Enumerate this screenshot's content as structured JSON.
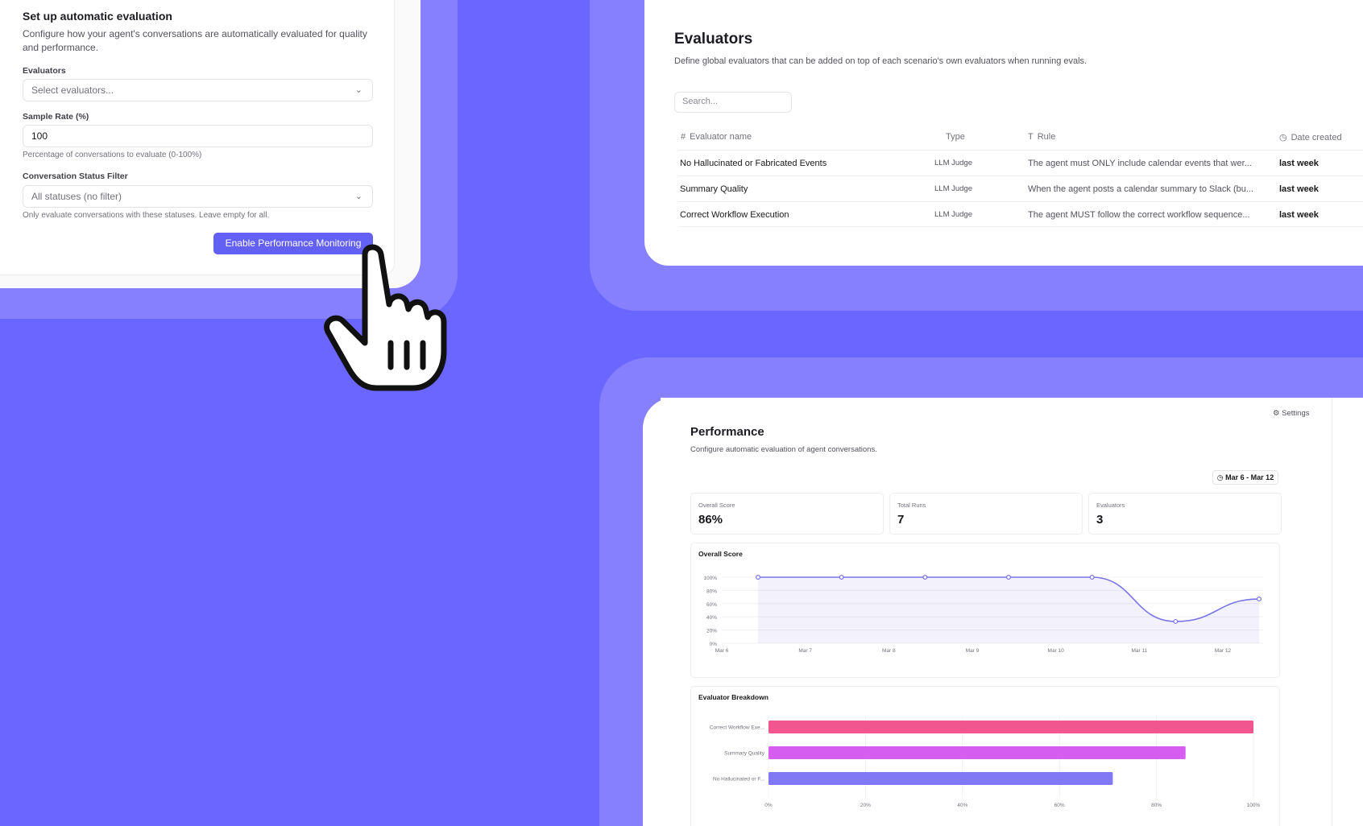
{
  "setup": {
    "title": "Set up automatic evaluation",
    "description": "Configure how your agent's conversations are automatically evaluated for quality and performance.",
    "evaluators_label": "Evaluators",
    "evaluators_placeholder": "Select evaluators...",
    "sample_rate_label": "Sample Rate (%)",
    "sample_rate_value": "100",
    "sample_rate_help": "Percentage of conversations to evaluate (0-100%)",
    "status_filter_label": "Conversation Status Filter",
    "status_filter_value": "All statuses (no filter)",
    "status_filter_help": "Only evaluate conversations with these statuses. Leave empty for all.",
    "enable_button": "Enable Performance Monitoring"
  },
  "evaluators": {
    "title": "Evaluators",
    "description": "Define global evaluators that can be added on top of each scenario's own evaluators when running evals.",
    "search_placeholder": "Search...",
    "columns": {
      "name": "Evaluator name",
      "type": "Type",
      "rule": "Rule",
      "date": "Date created"
    },
    "rows": [
      {
        "name": "No Hallucinated or Fabricated Events",
        "type": "LLM Judge",
        "rule": "The agent must ONLY include calendar events that wer...",
        "date": "last week"
      },
      {
        "name": "Summary Quality",
        "type": "LLM Judge",
        "rule": "When the agent posts a calendar summary to Slack (bu...",
        "date": "last week"
      },
      {
        "name": "Correct Workflow Execution",
        "type": "LLM Judge",
        "rule": "The agent MUST follow the correct workflow sequence...",
        "date": "last week"
      }
    ]
  },
  "performance": {
    "settings_label": "Settings",
    "title": "Performance",
    "description": "Configure automatic evaluation of agent conversations.",
    "date_range": "Mar 6 - Mar 12",
    "stats": [
      {
        "label": "Overall Score",
        "value": "86%"
      },
      {
        "label": "Total Runs",
        "value": "7"
      },
      {
        "label": "Evaluators",
        "value": "3"
      }
    ],
    "overall_panel_title": "Overall Score",
    "breakdown_panel_title": "Evaluator Breakdown"
  },
  "chart_data": [
    {
      "type": "area",
      "title": "Overall Score",
      "x": [
        "Mar 6",
        "Mar 7",
        "Mar 8",
        "Mar 9",
        "Mar 10",
        "Mar 11",
        "Mar 12"
      ],
      "series": [
        {
          "values": [
            100,
            100,
            100,
            100,
            100,
            33,
            67
          ]
        }
      ],
      "y_ticks": [
        "0%",
        "20%",
        "40%",
        "60%",
        "80%",
        "100%"
      ],
      "ylim": [
        0,
        100
      ],
      "grid": true,
      "color": "#7b74e6"
    },
    {
      "type": "bar",
      "orientation": "horizontal",
      "title": "Evaluator Breakdown",
      "categories": [
        "Correct Workflow Exe...",
        "Summary Quality",
        "No Hallucinated or F..."
      ],
      "values": [
        100,
        86,
        71
      ],
      "colors": [
        "#f2568f",
        "#d55ef0",
        "#8178f5"
      ],
      "x_ticks": [
        "0%",
        "20%",
        "40%",
        "60%",
        "80%",
        "100%"
      ],
      "xlim": [
        0,
        100
      ],
      "grid": true
    }
  ]
}
